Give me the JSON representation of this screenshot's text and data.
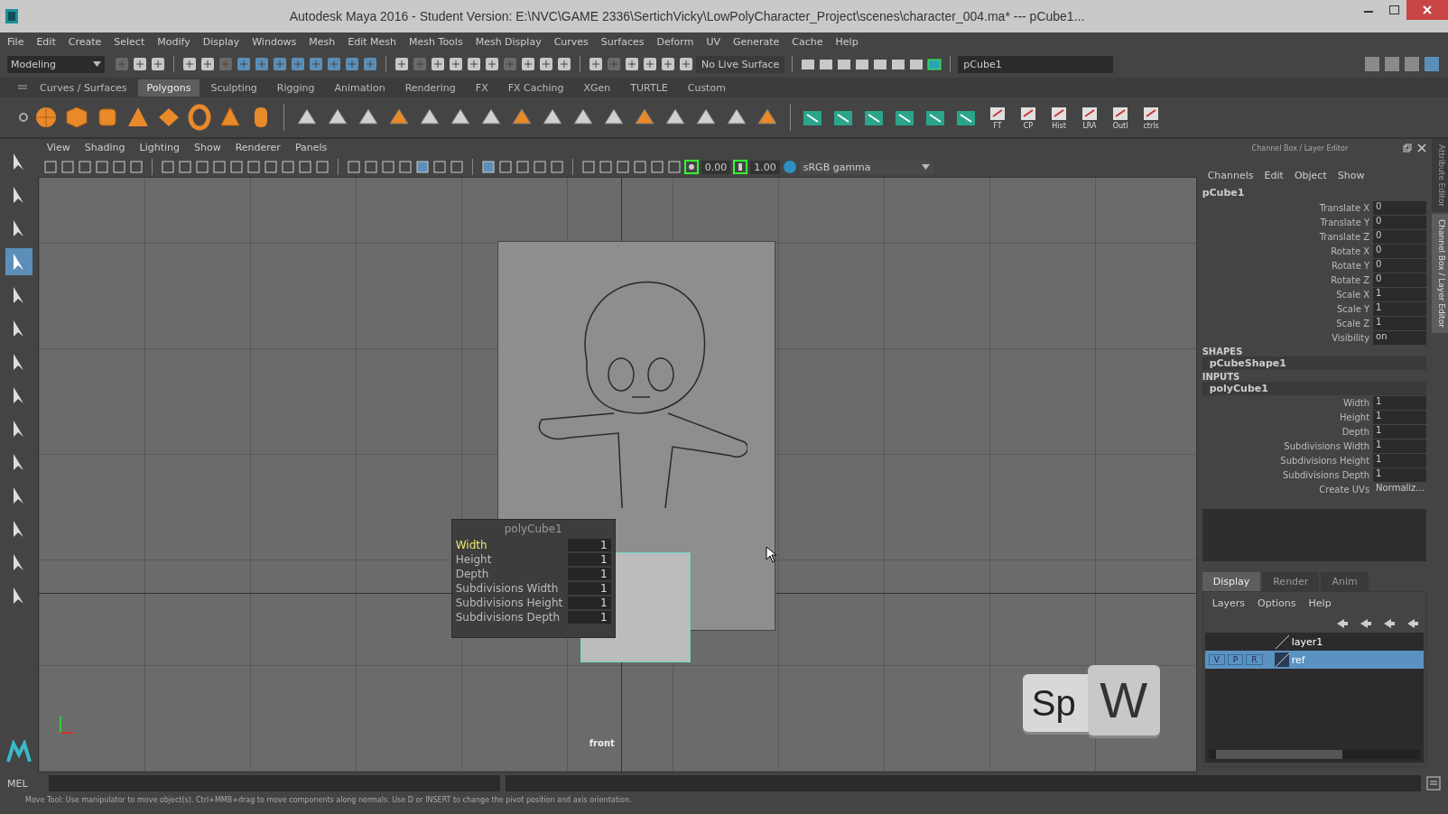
{
  "window": {
    "title": "Autodesk Maya 2016 - Student Version: E:\\NVC\\GAME 2336\\SertichVicky\\LowPolyCharacter_Project\\scenes\\character_004.ma*  ---  pCube1..."
  },
  "menu_bar": [
    "File",
    "Edit",
    "Create",
    "Select",
    "Modify",
    "Display",
    "Windows",
    "Mesh",
    "Edit Mesh",
    "Mesh Tools",
    "Mesh Display",
    "Curves",
    "Surfaces",
    "Deform",
    "UV",
    "Generate",
    "Cache",
    "Help"
  ],
  "status_line": {
    "mode": "Modeling",
    "live_surface": "No Live Surface",
    "name_field": "pCube1"
  },
  "shelf": {
    "tabs": [
      {
        "label": "Curves / Surfaces",
        "selected": false
      },
      {
        "label": "Polygons",
        "selected": true
      },
      {
        "label": "Sculpting",
        "selected": false
      },
      {
        "label": "Rigging",
        "selected": false
      },
      {
        "label": "Animation",
        "selected": false
      },
      {
        "label": "Rendering",
        "selected": false
      },
      {
        "label": "FX",
        "selected": false
      },
      {
        "label": "FX Caching",
        "selected": false
      },
      {
        "label": "XGen",
        "selected": false
      },
      {
        "label": "TURTLE",
        "selected": false
      },
      {
        "label": "Custom",
        "selected": false
      }
    ],
    "icon_labels": [
      "FT",
      "CP",
      "Hist",
      "LRA",
      "Outl",
      "ctrls"
    ]
  },
  "viewport": {
    "menu": [
      "View",
      "Shading",
      "Lighting",
      "Show",
      "Renderer",
      "Panels"
    ],
    "exposure": "0.00",
    "gamma": "1.00",
    "color_space": "sRGB gamma",
    "camera_label": "front"
  },
  "in_view_editor": {
    "title": "polyCube1",
    "rows": [
      {
        "label": "Width",
        "value": "1",
        "selected": true
      },
      {
        "label": "Height",
        "value": "1",
        "selected": false
      },
      {
        "label": "Depth",
        "value": "1",
        "selected": false
      },
      {
        "label": "Subdivisions Width",
        "value": "1",
        "selected": false
      },
      {
        "label": "Subdivisions Height",
        "value": "1",
        "selected": false
      },
      {
        "label": "Subdivisions Depth",
        "value": "1",
        "selected": false
      }
    ]
  },
  "keystroke_overlay": [
    "Sp",
    "W"
  ],
  "channel_box": {
    "title": "Channel Box / Layer Editor",
    "menu": [
      "Channels",
      "Edit",
      "Object",
      "Show"
    ],
    "object": "pCube1",
    "attributes": [
      {
        "label": "Translate X",
        "value": "0"
      },
      {
        "label": "Translate Y",
        "value": "0"
      },
      {
        "label": "Translate Z",
        "value": "0"
      },
      {
        "label": "Rotate X",
        "value": "0"
      },
      {
        "label": "Rotate Y",
        "value": "0"
      },
      {
        "label": "Rotate Z",
        "value": "0"
      },
      {
        "label": "Scale X",
        "value": "1"
      },
      {
        "label": "Scale Y",
        "value": "1"
      },
      {
        "label": "Scale Z",
        "value": "1"
      },
      {
        "label": "Visibility",
        "value": "on"
      }
    ],
    "shapes_header": "SHAPES",
    "shape": "pCubeShape1",
    "inputs_header": "INPUTS",
    "input": "polyCube1",
    "input_attributes": [
      {
        "label": "Width",
        "value": "1"
      },
      {
        "label": "Height",
        "value": "1"
      },
      {
        "label": "Depth",
        "value": "1"
      },
      {
        "label": "Subdivisions Width",
        "value": "1"
      },
      {
        "label": "Subdivisions Height",
        "value": "1"
      },
      {
        "label": "Subdivisions Depth",
        "value": "1"
      },
      {
        "label": "Create UVs",
        "value": "Normaliz..."
      }
    ]
  },
  "layer_editor": {
    "tabs": [
      {
        "label": "Display",
        "selected": true
      },
      {
        "label": "Render",
        "selected": false
      },
      {
        "label": "Anim",
        "selected": false
      }
    ],
    "menu": [
      "Layers",
      "Options",
      "Help"
    ],
    "layers": [
      {
        "name": "layer1",
        "selected": false
      },
      {
        "name": "ref",
        "selected": true,
        "buttons": [
          "V",
          "P",
          "R"
        ]
      }
    ]
  },
  "side_tabs": [
    {
      "label": "Attribute Editor",
      "selected": false
    },
    {
      "label": "Channel Box / Layer Editor",
      "selected": true
    }
  ],
  "command_line": {
    "language": "MEL"
  },
  "help_line": "Move Tool: Use manipulator to move object(s). Ctrl+MMB+drag to move components along normals. Use D or INSERT to change the pivot position and axis orientation."
}
